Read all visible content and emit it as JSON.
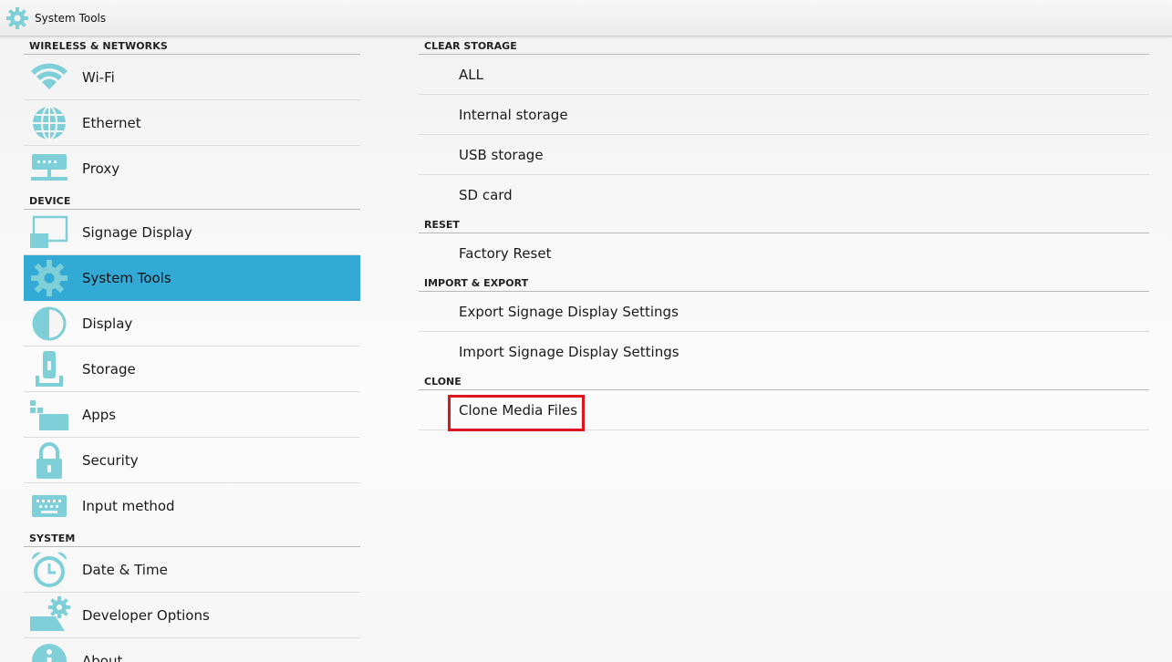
{
  "window": {
    "title": "System Tools",
    "icon": "gear-icon"
  },
  "sidebar": {
    "sections": [
      {
        "header": "WIRELESS & NETWORKS",
        "items": [
          {
            "label": "Wi-Fi",
            "icon": "wifi-icon"
          },
          {
            "label": "Ethernet",
            "icon": "globe-icon"
          },
          {
            "label": "Proxy",
            "icon": "proxy-server-icon"
          }
        ]
      },
      {
        "header": "DEVICE",
        "items": [
          {
            "label": "Signage Display",
            "icon": "display-cast-icon"
          },
          {
            "label": "System Tools",
            "icon": "gear-icon",
            "selected": true
          },
          {
            "label": "Display",
            "icon": "brightness-icon"
          },
          {
            "label": "Storage",
            "icon": "storage-icon"
          },
          {
            "label": "Apps",
            "icon": "apps-icon"
          },
          {
            "label": "Security",
            "icon": "lock-icon"
          },
          {
            "label": "Input method",
            "icon": "keyboard-icon"
          }
        ]
      },
      {
        "header": "SYSTEM",
        "items": [
          {
            "label": "Date & Time",
            "icon": "alarm-clock-icon"
          },
          {
            "label": "Developer Options",
            "icon": "developer-gear-icon"
          },
          {
            "label": "About",
            "icon": "info-icon"
          }
        ]
      }
    ]
  },
  "main": {
    "sections": [
      {
        "header": "CLEAR STORAGE",
        "items": [
          "ALL",
          "Internal storage",
          "USB storage",
          "SD card"
        ]
      },
      {
        "header": "RESET",
        "items": [
          "Factory Reset"
        ]
      },
      {
        "header": "IMPORT & EXPORT",
        "items": [
          "Export Signage Display Settings",
          "Import Signage Display Settings"
        ]
      },
      {
        "header": "CLONE",
        "items": [
          "Clone Media Files"
        ]
      }
    ]
  },
  "colors": {
    "accent": "#33a9d6",
    "icon": "#7fcfd8",
    "highlight": "#e0141e"
  }
}
